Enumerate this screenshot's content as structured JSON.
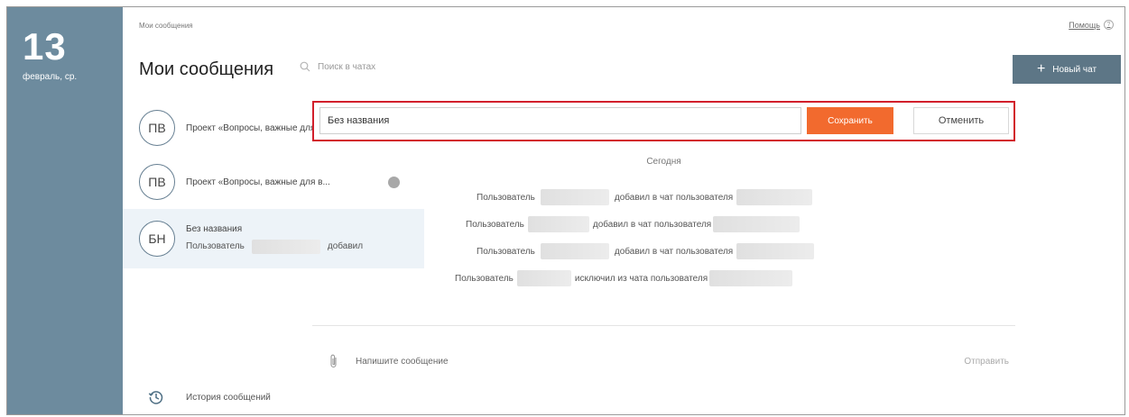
{
  "sidebar_date": {
    "day": "13",
    "subtitle": "февраль, ср."
  },
  "breadcrumb": "Мои сообщения",
  "help": {
    "label": "Помощь",
    "icon": "question-icon"
  },
  "header": {
    "title": "Мои сообщения",
    "search_placeholder": "Поиск в чатах",
    "new_chat_label": "Новый чат"
  },
  "chats": [
    {
      "initials": "ПВ",
      "title": "Проект «Вопросы, важные для в...",
      "unread_badge": true
    },
    {
      "initials": "ПВ",
      "title": "Проект «Вопросы, важные для в...",
      "unread_badge": true
    },
    {
      "initials": "БН",
      "title": "Без названия",
      "preview_prefix": "Пользователь",
      "preview_suffix": "добавил",
      "active": true
    }
  ],
  "history_label": "История сообщений",
  "rename": {
    "value": "Без названия",
    "save_label": "Сохранить",
    "cancel_label": "Отменить"
  },
  "messages": {
    "day_label": "Сегодня",
    "items": [
      {
        "prefix": "Пользователь",
        "action": "добавил в чат пользователя"
      },
      {
        "prefix": "Пользователь",
        "action": "добавил в чат пользователя"
      },
      {
        "prefix": "Пользователь",
        "action": "добавил в чат пользователя"
      },
      {
        "prefix": "Пользователь",
        "action": "исключил из чата пользователя"
      }
    ]
  },
  "composer": {
    "placeholder": "Напишите сообщение",
    "send_label": "Отправить"
  },
  "colors": {
    "accent": "#f26a2e",
    "sidebar": "#6d8b9e",
    "highlight_border": "#d21f2b",
    "new_chat_bg": "#5d7686"
  }
}
